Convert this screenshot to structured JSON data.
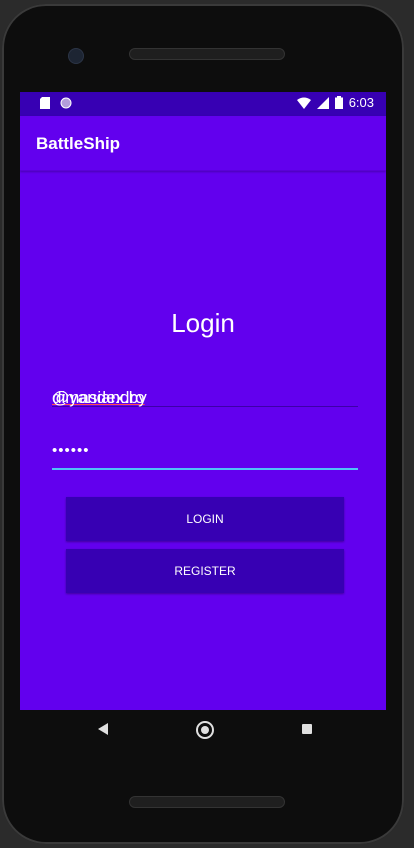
{
  "status_bar": {
    "time": "6:03",
    "icons_left": [
      "sd-card-icon",
      "sync-icon"
    ],
    "icons_right": [
      "wifi-icon",
      "signal-icon",
      "battery-icon"
    ]
  },
  "app_bar": {
    "title": "BattleShip"
  },
  "login": {
    "heading": "Login",
    "email_value_prefix": "dimasiandro",
    "email_value_suffix": "@yandex.by",
    "password_value": "••••••",
    "login_button": "LOGIN",
    "register_button": "REGISTER"
  },
  "nav_bar": {
    "icons": [
      "back-icon",
      "home-icon",
      "recents-icon"
    ]
  },
  "colors": {
    "primary": "#6200ee",
    "primary_dark": "#3700b3",
    "accent": "#4fc3f7"
  }
}
